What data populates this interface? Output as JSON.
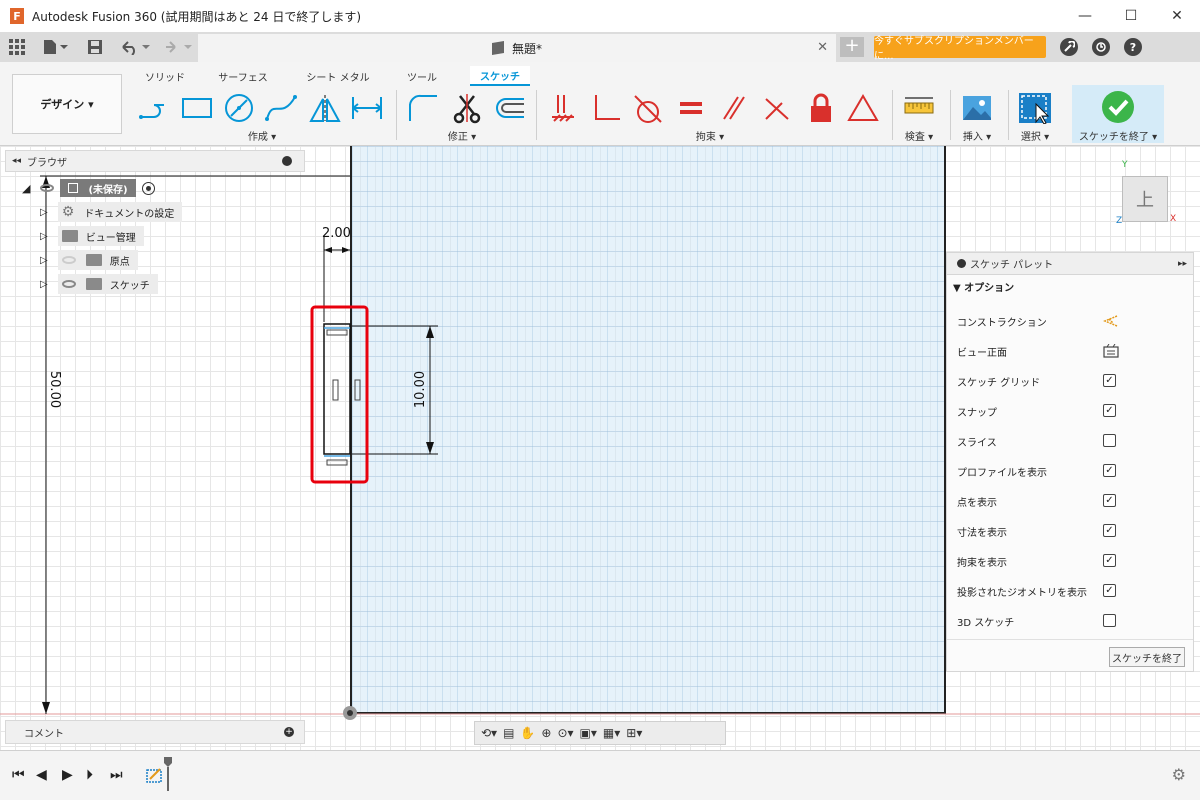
{
  "window": {
    "title": "Autodesk Fusion 360 (試用期間はあと 24 日で終了します)",
    "minimize": "—",
    "maximize": "☐",
    "close": "✕",
    "logo_letter": "F"
  },
  "tabbar": {
    "doc_title": "無題*",
    "subscription_label": "今すぐサブスクリプションメンバーに...",
    "help_label": "?"
  },
  "ribbon": {
    "design_label": "デザイン ▾",
    "tabs": [
      "ソリッド",
      "サーフェス",
      "シート メタル",
      "ツール",
      "スケッチ"
    ],
    "groups": {
      "create": "作成 ▾",
      "modify": "修正 ▾",
      "constraints": "拘束 ▾",
      "inspect": "検査 ▾",
      "insert": "挿入 ▾",
      "select": "選択 ▾",
      "finish": "スケッチを終了 ▾"
    }
  },
  "browser": {
    "title": "ブラウザ",
    "root": "(未保存)",
    "items": [
      "ドキュメントの設定",
      "ビュー管理",
      "原点",
      "スケッチ"
    ]
  },
  "canvas": {
    "dim_width": "2.00",
    "dim_height": "10.00",
    "dim_vertical": "50.00",
    "viewcube_face": "上",
    "axis_y": "Y",
    "axis_x": "X",
    "axis_z": "Z"
  },
  "palette": {
    "title": "スケッチ パレット",
    "section": "▼ オプション",
    "rows": [
      {
        "label": "コンストラクション",
        "type": "icon"
      },
      {
        "label": "ビュー正面",
        "type": "icon"
      },
      {
        "label": "スケッチ グリッド",
        "type": "checkbox",
        "checked": true
      },
      {
        "label": "スナップ",
        "type": "checkbox",
        "checked": true
      },
      {
        "label": "スライス",
        "type": "checkbox",
        "checked": false
      },
      {
        "label": "プロファイルを表示",
        "type": "checkbox",
        "checked": true
      },
      {
        "label": "点を表示",
        "type": "checkbox",
        "checked": true
      },
      {
        "label": "寸法を表示",
        "type": "checkbox",
        "checked": true
      },
      {
        "label": "拘束を表示",
        "type": "checkbox",
        "checked": true
      },
      {
        "label": "投影されたジオメトリを表示",
        "type": "checkbox",
        "checked": true
      },
      {
        "label": "3D スケッチ",
        "type": "checkbox",
        "checked": false
      }
    ],
    "finish_button": "スケッチを終了"
  },
  "comment": {
    "label": "コメント"
  },
  "colors": {
    "accent": "#0696d7",
    "subscription": "#f7a21b",
    "finish_check": "#3cb54a",
    "constraint_red": "#d9302c",
    "highlight_red": "#e8000d"
  }
}
